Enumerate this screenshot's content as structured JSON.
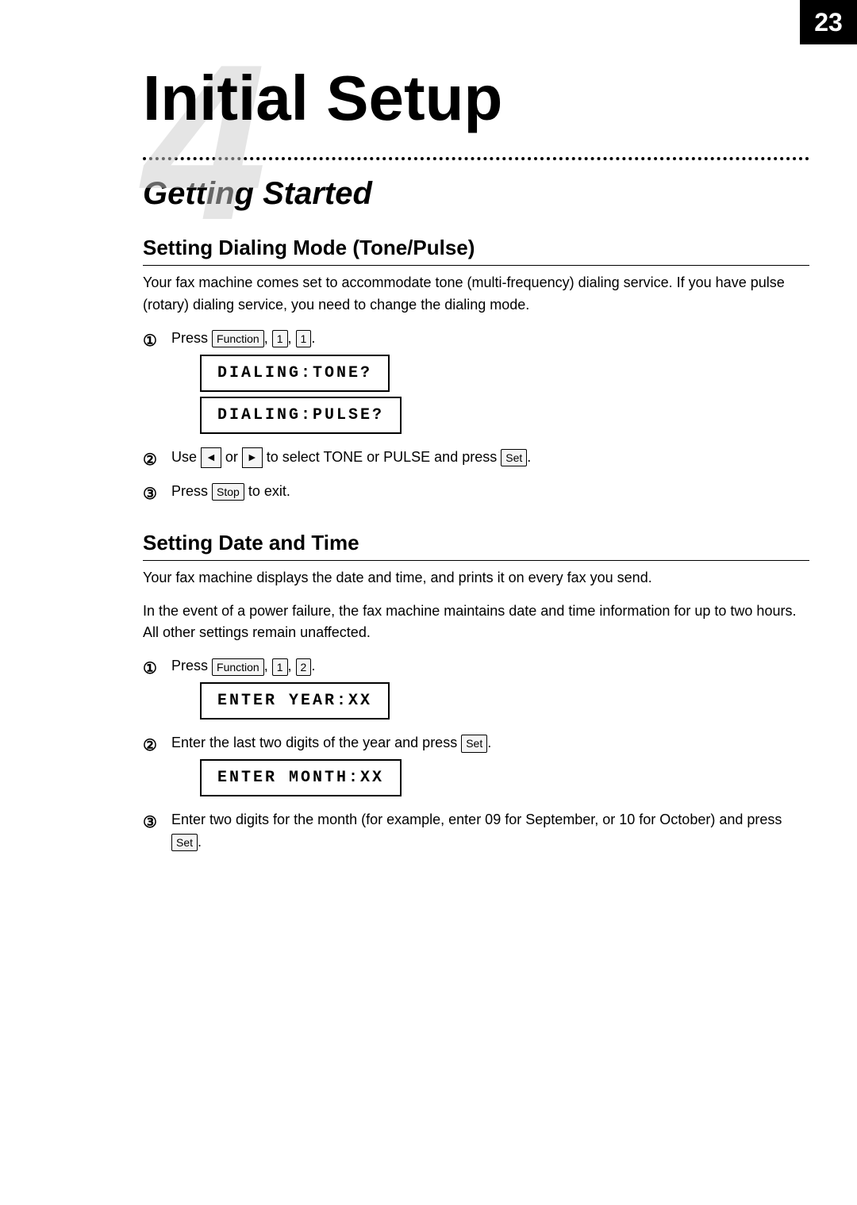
{
  "page": {
    "number": "23",
    "chapter_number": "4",
    "chapter_title": "Initial Setup",
    "section_heading": "Getting Started",
    "subsections": [
      {
        "id": "dialing-mode",
        "title": "Setting Dialing Mode (Tone/Pulse)",
        "intro": "Your fax machine comes set to accommodate tone (multi-frequency) dialing service. If you have pulse (rotary) dialing service, you need to change the dialing mode.",
        "steps": [
          {
            "number": "1",
            "text_before": "Press ",
            "keys": [
              "Function",
              "1",
              "1"
            ],
            "text_after": "",
            "displays": [
              "DIALING:TONE?",
              "DIALING:PULSE?"
            ]
          },
          {
            "number": "2",
            "text": "Use",
            "arrow_left": "◄",
            "or": "or",
            "arrow_right": "►",
            "text2": "to select TONE or PULSE and press",
            "key_end": "Set"
          },
          {
            "number": "3",
            "text": "Press",
            "key": "Stop",
            "text_end": "to exit."
          }
        ]
      },
      {
        "id": "date-time",
        "title": "Setting Date and Time",
        "intro1": "Your fax machine displays the date and time, and prints it on every fax you send.",
        "intro2": "In the event of a power failure, the fax machine maintains date and time information for up to two hours. All other settings remain unaffected.",
        "steps": [
          {
            "number": "1",
            "text_before": "Press ",
            "keys": [
              "Function",
              "1",
              "2"
            ],
            "text_after": "",
            "displays": [
              "ENTER YEAR:XX"
            ]
          },
          {
            "number": "2",
            "text": "Enter the last two digits of the year and press",
            "key_end": "Set",
            "text_end": ".",
            "displays": [
              "ENTER MONTH:XX"
            ]
          },
          {
            "number": "3",
            "text": "Enter two digits for the month (for example, enter 09 for September, or 10 for October) and press",
            "key_end": "Set",
            "text_end": "."
          }
        ]
      }
    ]
  }
}
